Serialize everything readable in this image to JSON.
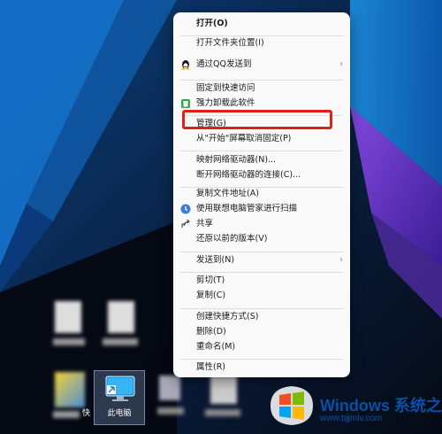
{
  "menu": {
    "items": [
      {
        "label": "打开(O)",
        "icon": null,
        "submenu": false,
        "bold": true
      },
      {
        "label": "打开文件夹位置(I)",
        "icon": null,
        "submenu": false
      },
      {
        "label": "通过QQ发送到",
        "icon": "qq-penguin-icon",
        "submenu": true
      },
      {
        "label": "固定到快速访问",
        "icon": null,
        "submenu": false
      },
      {
        "label": "强力卸载此软件",
        "icon": "uninstall-trash-icon",
        "submenu": false
      },
      {
        "label": "管理(G)",
        "icon": null,
        "submenu": false,
        "highlighted": true
      },
      {
        "label": "从\"开始\"屏幕取消固定(P)",
        "icon": null,
        "submenu": false
      },
      {
        "label": "映射网络驱动器(N)...",
        "icon": null,
        "submenu": false
      },
      {
        "label": "断开网络驱动器的连接(C)...",
        "icon": null,
        "submenu": false
      },
      {
        "label": "复制文件地址(A)",
        "icon": null,
        "submenu": false
      },
      {
        "label": "使用联想电脑管家进行扫描",
        "icon": "lenovo-scan-icon",
        "submenu": false
      },
      {
        "label": "共享",
        "icon": "share-icon",
        "submenu": false
      },
      {
        "label": "还原以前的版本(V)",
        "icon": null,
        "submenu": false
      },
      {
        "label": "发送到(N)",
        "icon": null,
        "submenu": true
      },
      {
        "label": "剪切(T)",
        "icon": null,
        "submenu": false
      },
      {
        "label": "复制(C)",
        "icon": null,
        "submenu": false
      },
      {
        "label": "创建快捷方式(S)",
        "icon": null,
        "submenu": false
      },
      {
        "label": "删除(D)",
        "icon": null,
        "submenu": false
      },
      {
        "label": "重命名(M)",
        "icon": null,
        "submenu": false
      },
      {
        "label": "属性(R)",
        "icon": null,
        "submenu": false
      }
    ],
    "highlight_color": "#e0211b"
  },
  "desktop": {
    "this_pc_label": "此电脑",
    "partial_label": "快"
  },
  "watermark": {
    "title": "Windows 系统之家",
    "url": "www.bjjmlv.com",
    "color": "#0a4fa6"
  }
}
